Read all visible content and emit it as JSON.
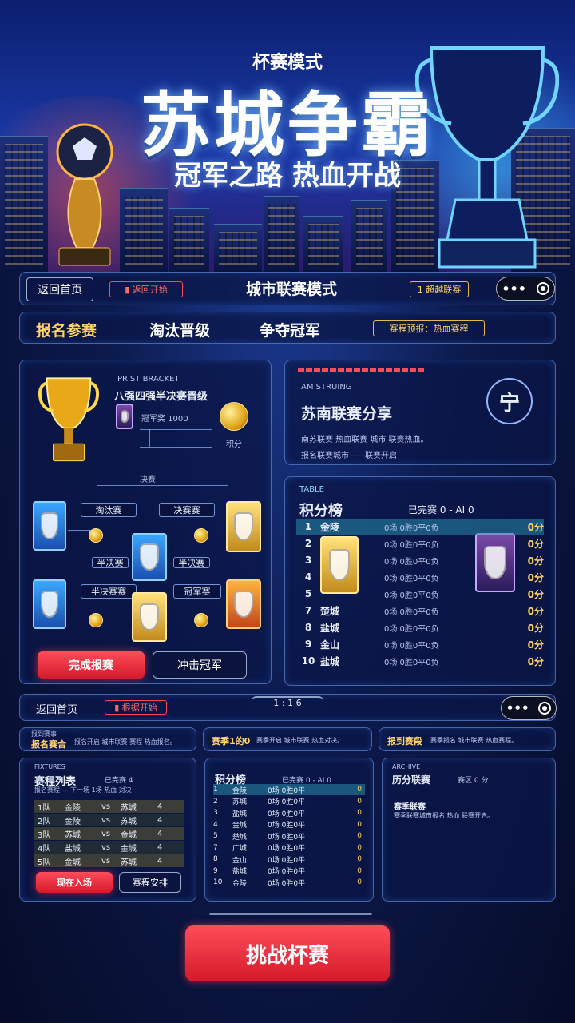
{
  "hero": {
    "mode_label": "杯赛模式",
    "title": "苏城争霸",
    "slogan": "冠军之路 热血开战"
  },
  "nav_bar_1": {
    "back_label": "返回首页",
    "red_chip": "▮ 返回开始",
    "title": "城市联赛模式",
    "gold_chip": "1 超越联赛",
    "menu_icon": "more-dots-icon",
    "target_icon": "target-circle-icon"
  },
  "stage_bar": {
    "stage_1": "报名参赛",
    "stage_2": "淘汰晋级",
    "stage_3": "争夺冠军",
    "info_chip": "赛程预报：热血赛程"
  },
  "bracket_panel": {
    "header_small": "PRIST BRACKET",
    "header_title": "八强四强半决赛晋级",
    "info_line": "冠军奖 1000",
    "reward_label": "积分",
    "round_label": "决赛",
    "node_quarter_left": "淘汰赛",
    "node_quarter_right": "决赛赛",
    "node_semi_left": "半决赛",
    "node_semi_left_bottom": "半决赛赛",
    "node_semi_right": "半决赛",
    "node_semi_right_bottom": "冠军赛",
    "complete_button": "完成报赛",
    "challenge_button": "冲击冠军"
  },
  "league_panel": {
    "header_small": "AM STRUING",
    "title": "苏南联赛分享",
    "desc_1": "南苏联赛 热血联赛 城市 联赛热血。",
    "desc_2": "报名联赛城市——联赛开启",
    "badge_char": "宁"
  },
  "table_panel": {
    "header_small": "TABLE",
    "title": "积分榜",
    "status": "已完赛 0 - AI 0",
    "rows": [
      {
        "rank": "1",
        "team": "金陵",
        "stats": "0场 0胜0平0负",
        "pts": "0分"
      },
      {
        "rank": "2",
        "team": "",
        "stats": "0场 0胜0平0负",
        "pts": "0分"
      },
      {
        "rank": "3",
        "team": "",
        "stats": "0场 0胜0平0负",
        "pts": "0分"
      },
      {
        "rank": "4",
        "team": "",
        "stats": "0场 0胜0平0负",
        "pts": "0分"
      },
      {
        "rank": "5",
        "team": "",
        "stats": "0场 0胜0平0负",
        "pts": "0分"
      },
      {
        "rank": "7",
        "team": "楚城",
        "stats": "0场 0胜0平0负",
        "pts": "0分"
      },
      {
        "rank": "8",
        "team": "盐城",
        "stats": "0场 0胜0平0负",
        "pts": "0分"
      },
      {
        "rank": "9",
        "team": "金山",
        "stats": "0场 0胜0平0负",
        "pts": "0分"
      },
      {
        "rank": "10",
        "team": "盐城",
        "stats": "0场 0胜0平0负",
        "pts": "0分"
      }
    ]
  },
  "nav_bar_2": {
    "back_label": "返回首页",
    "red_chip": "▮ 根据开始",
    "center_label": "1 : 1 6",
    "menu_icon": "more-dots-icon",
    "target_icon": "target-circle-icon"
  },
  "info_strip": {
    "box1_small": "报到赛事",
    "box1_title": "报名赛合",
    "box1_text": "报名开启 城市联赛 赛程 热血报名。",
    "box2_title": "赛季1的0",
    "box2_text": "赛季开启 城市联赛 热血对决。",
    "box3_title": "报到赛段",
    "box3_text": "赛季报名 城市联赛 热血赛程。"
  },
  "mini_schedule": {
    "header_small": "FIXTURES",
    "title": "赛程列表",
    "status": "已完赛 4",
    "sub": "报名赛程 — 下一场 1场 热血 对决",
    "rows": [
      {
        "a": "1队",
        "b": "金陵",
        "vs": "vs",
        "c": "苏城",
        "d": "4"
      },
      {
        "a": "2队",
        "b": "金陵",
        "vs": "vs",
        "c": "苏城",
        "d": "4"
      },
      {
        "a": "3队",
        "b": "苏城",
        "vs": "vs",
        "c": "金城",
        "d": "4"
      },
      {
        "a": "4队",
        "b": "盐城",
        "vs": "vs",
        "c": "金城",
        "d": "4"
      },
      {
        "a": "5队",
        "b": "金城",
        "vs": "vs",
        "c": "苏城",
        "d": "4"
      }
    ],
    "button_red": "现在入场",
    "button_dark": "赛程安排"
  },
  "mini_table": {
    "title": "积分榜",
    "status": "已完赛 0 - AI 0",
    "rows": [
      {
        "rank": "1",
        "team": "金陵",
        "stats": "0场 0胜0平",
        "pts": "0"
      },
      {
        "rank": "2",
        "team": "苏城",
        "stats": "0场 0胜0平",
        "pts": "0"
      },
      {
        "rank": "3",
        "team": "盐城",
        "stats": "0场 0胜0平",
        "pts": "0"
      },
      {
        "rank": "4",
        "team": "金城",
        "stats": "0场 0胜0平",
        "pts": "0"
      },
      {
        "rank": "5",
        "team": "楚城",
        "stats": "0场 0胜0平",
        "pts": "0"
      },
      {
        "rank": "7",
        "team": "广城",
        "stats": "0场 0胜0平",
        "pts": "0"
      },
      {
        "rank": "8",
        "team": "金山",
        "stats": "0场 0胜0平",
        "pts": "0"
      },
      {
        "rank": "9",
        "team": "盐城",
        "stats": "0场 0胜0平",
        "pts": "0"
      },
      {
        "rank": "10",
        "team": "金陵",
        "stats": "0场 0胜0平",
        "pts": "0"
      }
    ]
  },
  "mini_share": {
    "header_small": "ARCHIVE",
    "title": "历分联赛",
    "status": "赛区 0 分",
    "subtitle": "赛季联赛",
    "text": "赛季联赛城市报名 热血 联赛开启。"
  },
  "cta": {
    "label": "挑战杯赛"
  },
  "colors": {
    "accent_red": "#e8283a",
    "gold": "#ffd36a",
    "panel_border": "#78aaff"
  }
}
